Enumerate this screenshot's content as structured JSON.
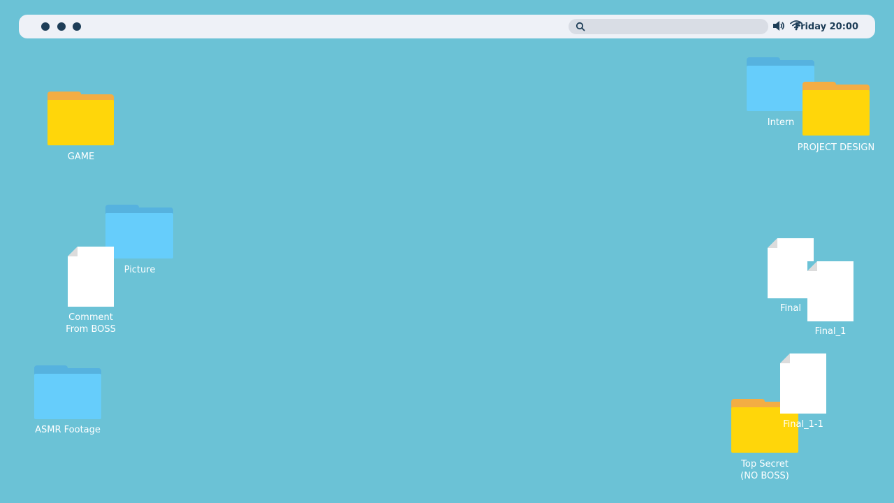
{
  "topbar": {
    "clock": "Friday 20:00",
    "icons": [
      "search-icon",
      "volume-icon",
      "wifi-icon"
    ]
  },
  "desktop": {
    "items": [
      {
        "type": "folder",
        "color": "yellow",
        "label": "GAME"
      },
      {
        "type": "folder",
        "color": "blue",
        "label": "Picture"
      },
      {
        "type": "file",
        "label_lines": [
          "Comment",
          "From BOSS"
        ]
      },
      {
        "type": "folder",
        "color": "blue",
        "label": "ASMR Footage"
      },
      {
        "type": "folder",
        "color": "blue",
        "label": "Intern"
      },
      {
        "type": "folder",
        "color": "yellow",
        "label": "PROJECT DESIGN"
      },
      {
        "type": "file",
        "label": "Final"
      },
      {
        "type": "file",
        "label": "Final_1"
      },
      {
        "type": "file",
        "label": "Final_1-1"
      },
      {
        "type": "folder",
        "color": "yellow",
        "label_lines": [
          "Top Secret",
          "(NO BOSS)"
        ]
      }
    ]
  },
  "colors": {
    "desktop_bg": "#6bc2d6",
    "folder_yellow": "#ffd60a",
    "folder_yellow_tab": "#f3ad44",
    "folder_blue": "#66cdfb",
    "folder_blue_tab": "#56b2df",
    "topbar_bg": "#eef1f7",
    "topbar_text": "#1d3d57"
  }
}
